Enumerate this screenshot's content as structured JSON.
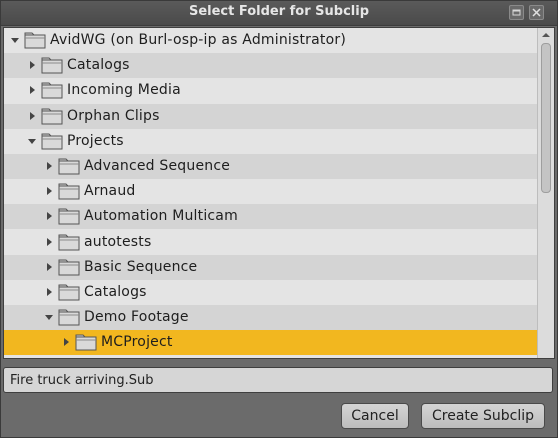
{
  "dialog": {
    "title": "Select Folder for Subclip",
    "filename": "Fire truck arriving.Sub",
    "cancel_label": "Cancel",
    "create_label": "Create Subclip"
  },
  "tree": {
    "items": [
      {
        "label": "AvidWG (on Burl-osp-ip as Administrator)",
        "level": 0,
        "expanded": true,
        "selected": false
      },
      {
        "label": "Catalogs",
        "level": 1,
        "expanded": false,
        "selected": false
      },
      {
        "label": "Incoming Media",
        "level": 1,
        "expanded": false,
        "selected": false
      },
      {
        "label": "Orphan Clips",
        "level": 1,
        "expanded": false,
        "selected": false
      },
      {
        "label": "Projects",
        "level": 1,
        "expanded": true,
        "selected": false
      },
      {
        "label": "Advanced Sequence",
        "level": 2,
        "expanded": false,
        "selected": false
      },
      {
        "label": "Arnaud",
        "level": 2,
        "expanded": false,
        "selected": false
      },
      {
        "label": "Automation Multicam",
        "level": 2,
        "expanded": false,
        "selected": false
      },
      {
        "label": "autotests",
        "level": 2,
        "expanded": false,
        "selected": false
      },
      {
        "label": "Basic Sequence",
        "level": 2,
        "expanded": false,
        "selected": false
      },
      {
        "label": "Catalogs",
        "level": 2,
        "expanded": false,
        "selected": false
      },
      {
        "label": "Demo Footage",
        "level": 2,
        "expanded": true,
        "selected": false
      },
      {
        "label": "MCProject",
        "level": 3,
        "expanded": false,
        "selected": true
      }
    ]
  },
  "colors": {
    "selected_row": "#f2b71f",
    "tree_bg": "#e4e4e4",
    "alt_row": "#d4d4d4"
  }
}
